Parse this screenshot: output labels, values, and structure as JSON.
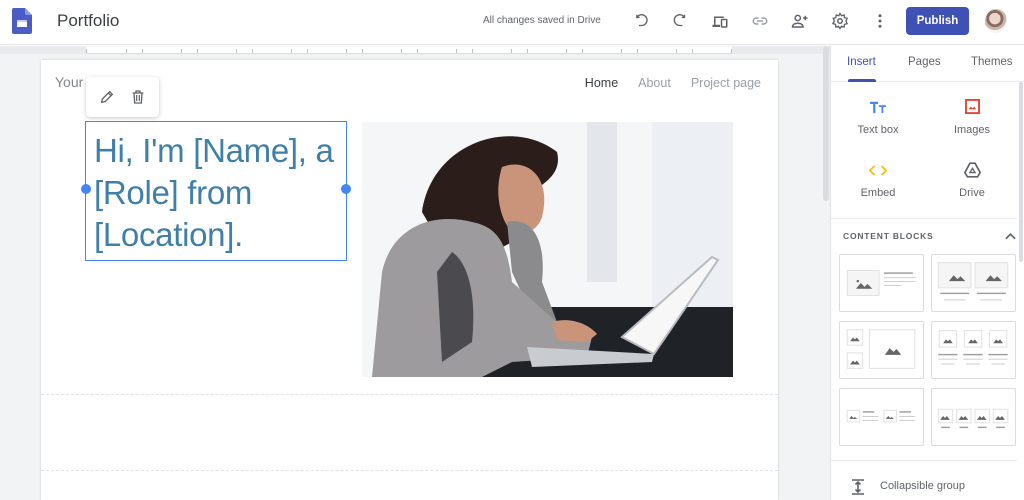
{
  "header": {
    "app_title": "Portfolio",
    "save_status": "All changes saved in Drive",
    "icons": [
      "undo-icon",
      "redo-icon",
      "preview-devices-icon",
      "link-icon",
      "share-add-person-icon",
      "settings-gear-icon",
      "more-vert-icon"
    ],
    "publish_label": "Publish",
    "colors": {
      "brand": "#4b5cc4",
      "publish": "#3f51b5"
    }
  },
  "page": {
    "site_name": "Your",
    "nav": [
      {
        "label": "Home",
        "active": true
      },
      {
        "label": "About",
        "active": false
      },
      {
        "label": "Project page",
        "active": false
      }
    ],
    "hero_text": "Hi, I'm [Name], a [Role] from [Location].",
    "hero_image_alt": "Woman smiling while typing on a laptop",
    "text_toolbar": {
      "edit_icon": "pencil-icon",
      "delete_icon": "trash-icon"
    },
    "colors": {
      "selection": "#4285f4",
      "hero_text": "#3f7fa8"
    }
  },
  "side_panel": {
    "tabs": [
      {
        "label": "Insert",
        "active": true
      },
      {
        "label": "Pages",
        "active": false
      },
      {
        "label": "Themes",
        "active": false
      }
    ],
    "insert_items": [
      {
        "label": "Text box",
        "icon": "text-box-icon"
      },
      {
        "label": "Images",
        "icon": "image-icon"
      },
      {
        "label": "Embed",
        "icon": "embed-code-icon"
      },
      {
        "label": "Drive",
        "icon": "drive-icon"
      }
    ],
    "content_blocks_title": "CONTENT BLOCKS",
    "content_blocks": [
      "image-with-text",
      "two-images-with-captions",
      "two-small-images-and-large-image",
      "three-images-with-captions",
      "two-images-with-side-text",
      "four-images-with-captions"
    ],
    "collapsible_group_label": "Collapsible group"
  }
}
